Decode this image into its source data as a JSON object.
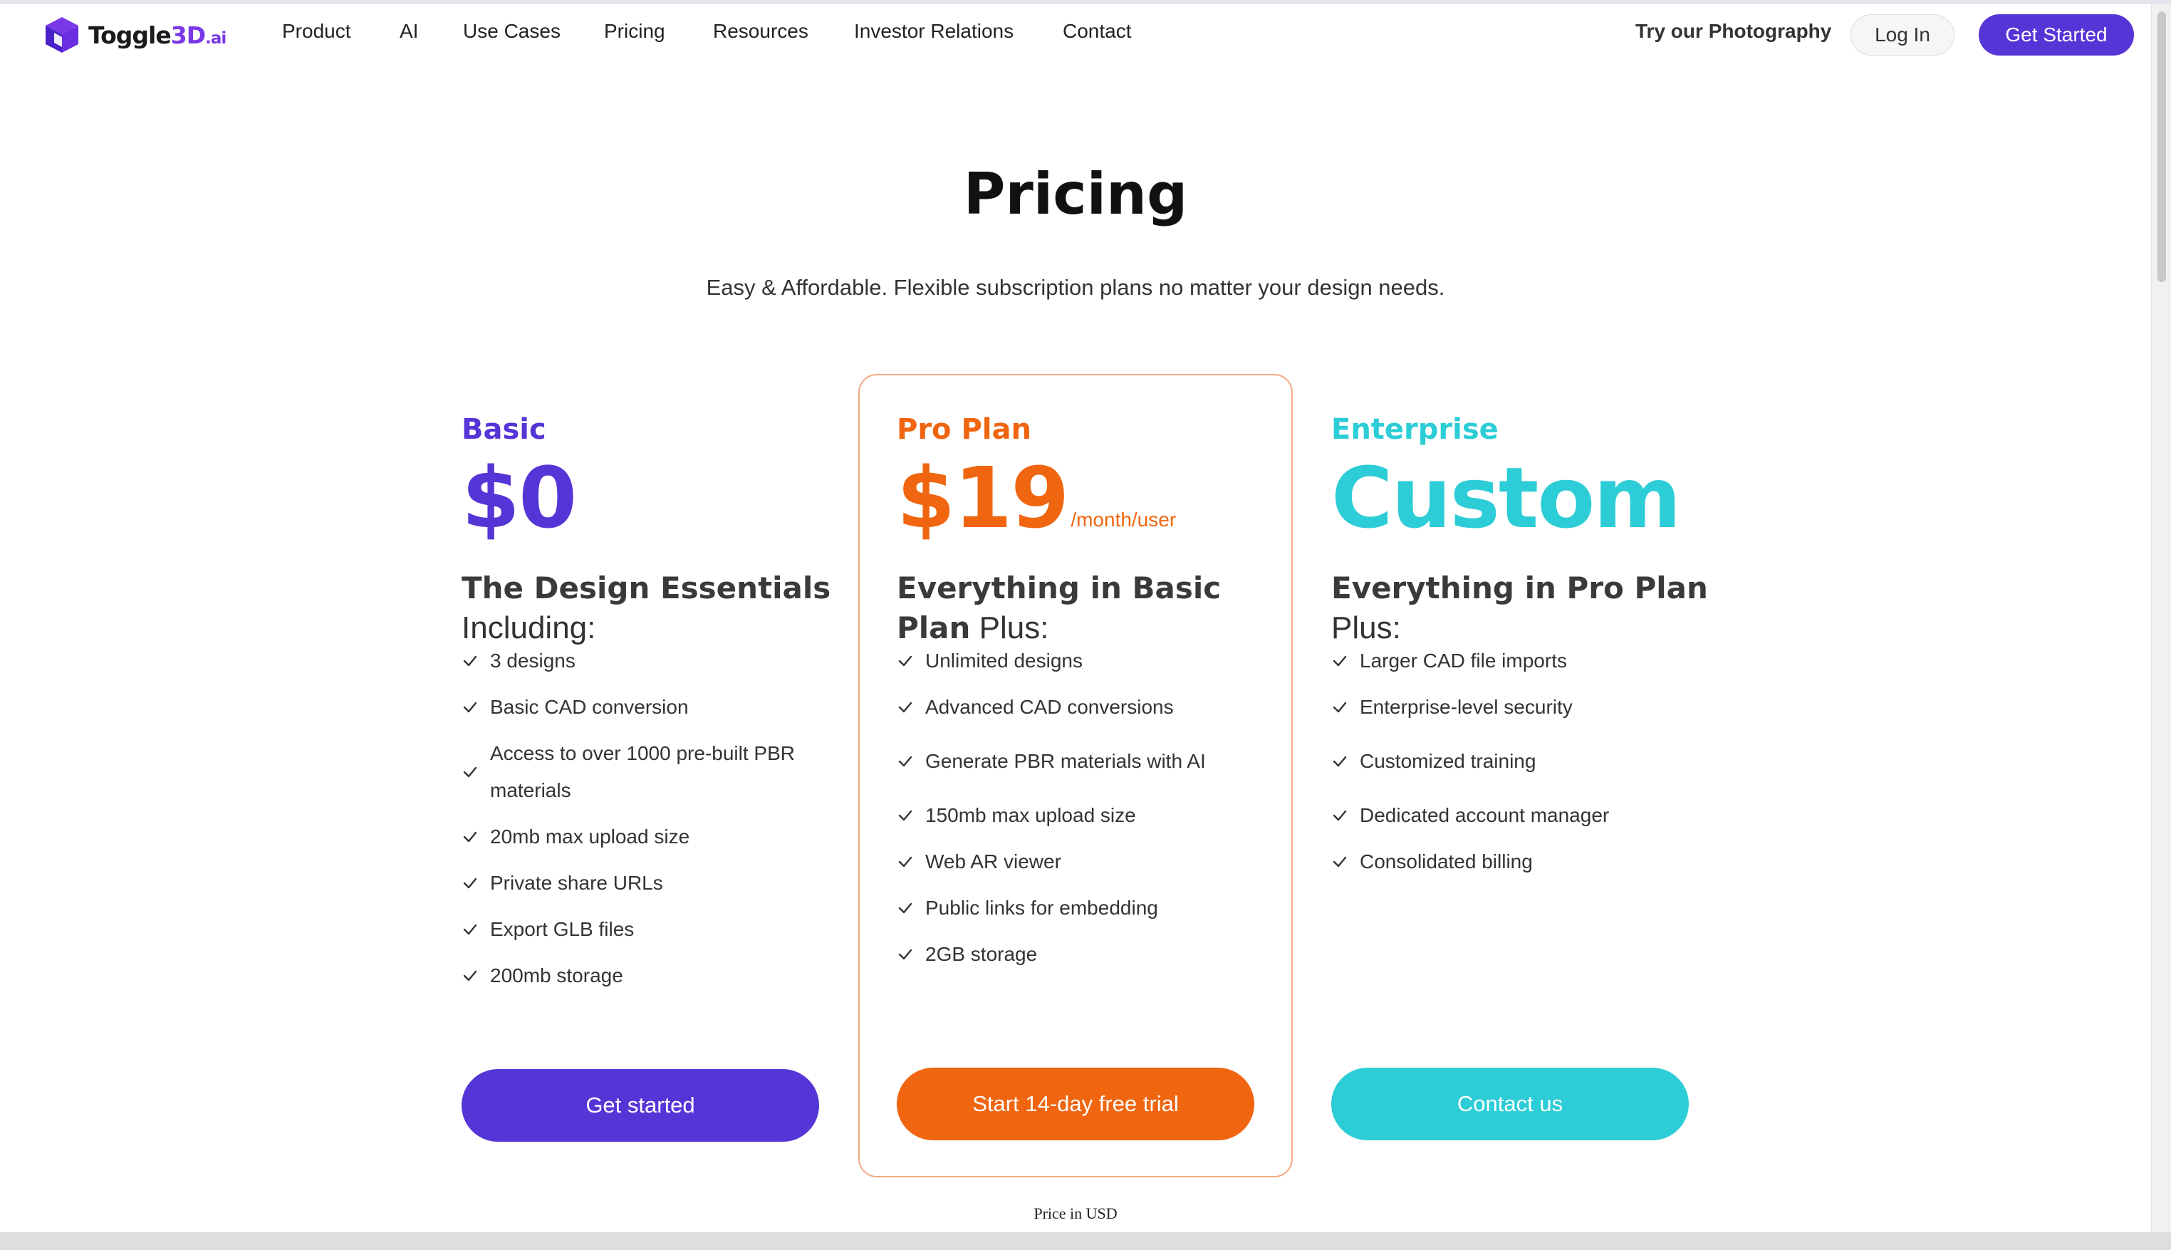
{
  "header": {
    "logo": {
      "part1": "Toggle",
      "part2": "3D",
      "part3": ".ai"
    },
    "nav": [
      "Product",
      "AI",
      "Use Cases",
      "Pricing",
      "Resources",
      "Investor Relations",
      "Contact"
    ],
    "try_photography": "Try our Photography",
    "login": "Log In",
    "get_started": "Get Started"
  },
  "hero": {
    "title": "Pricing",
    "subtitle": "Easy & Affordable. Flexible subscription plans no matter your design needs."
  },
  "plans": [
    {
      "name": "Basic",
      "price": "$0",
      "unit": "",
      "headline_bold": "The Design Essentials",
      "headline_rest": "Including:",
      "features": [
        "3 designs",
        "Basic CAD conversion",
        "Access to over 1000 pre-built PBR materials",
        "20mb max upload size",
        "Private share URLs",
        "Export GLB files",
        "200mb storage"
      ],
      "button": "Get started",
      "color": "#5535d6"
    },
    {
      "name": "Pro Plan",
      "price": "$19",
      "unit": "/month/user",
      "headline_bold": "Everything in Basic Plan",
      "headline_rest": "Plus:",
      "features": [
        "Unlimited designs",
        "Advanced CAD conversions",
        "Generate PBR materials with AI",
        "150mb max upload size",
        "Web AR viewer",
        "Public links for embedding",
        "2GB storage"
      ],
      "button": "Start 14-day free trial",
      "color": "#f06510"
    },
    {
      "name": "Enterprise",
      "price": "Custom",
      "unit": "",
      "headline_bold": "Everything in Pro Plan",
      "headline_rest": "Plus:",
      "features": [
        "Larger CAD file imports",
        "Enterprise-level security",
        "Customized training",
        "Dedicated account manager",
        "Consolidated billing"
      ],
      "button": "Contact us",
      "color": "#2ccdd6"
    }
  ],
  "footer_note": "Price in USD",
  "colors": {
    "brand": "#5535d6",
    "pro": "#f06510",
    "enterprise": "#2ccdd6",
    "logo_accent": "#7a38e8"
  },
  "icons": {
    "logo": "cube-logo-icon",
    "check": "check-icon"
  }
}
